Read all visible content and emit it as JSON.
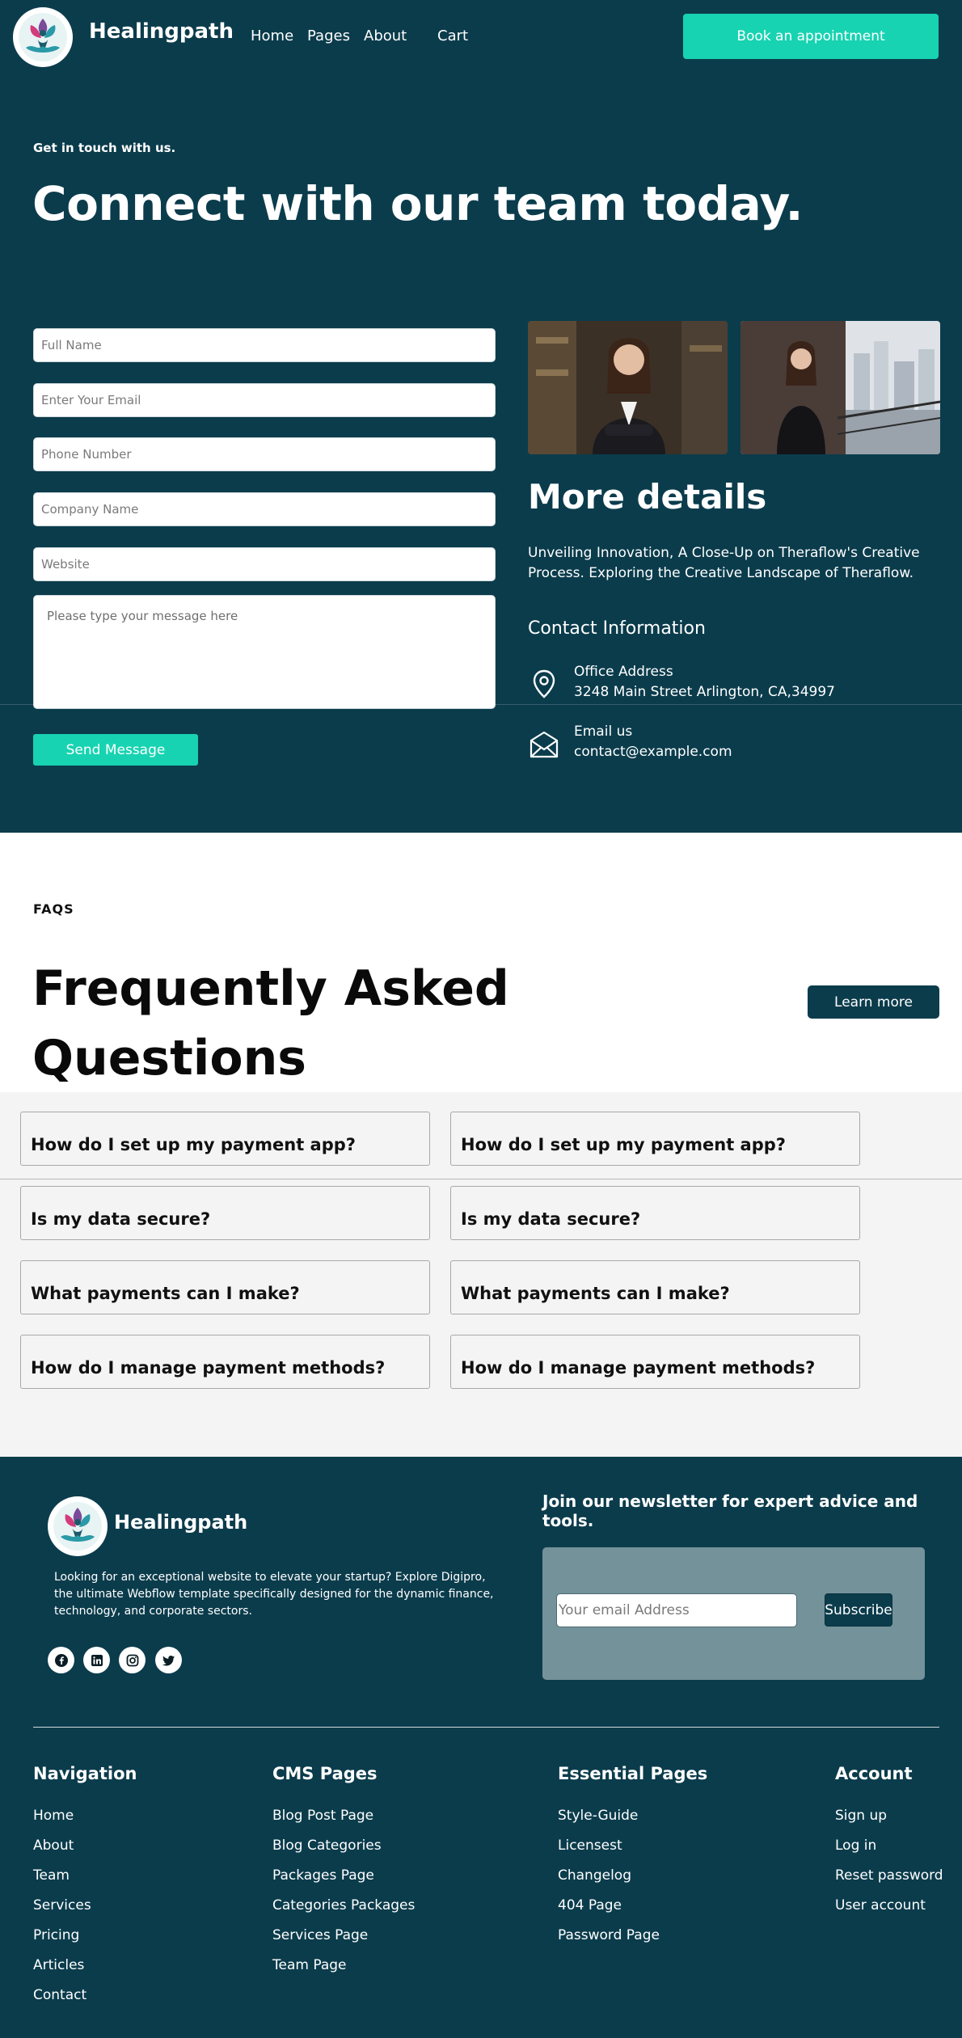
{
  "header": {
    "brand": "Healingpath",
    "nav": [
      "Home",
      "Pages",
      "About",
      "Cart"
    ],
    "cta": "Book an appointment"
  },
  "hero": {
    "eyebrow": "Get in touch with us.",
    "title": "Connect with our team today."
  },
  "form": {
    "full_name_placeholder": "Full Name",
    "email_placeholder": "Enter Your Email",
    "phone_placeholder": "Phone Number",
    "company_placeholder": "Company Name",
    "website_placeholder": "Website",
    "message_placeholder": "Please type your message here",
    "submit_label": "Send Message"
  },
  "details": {
    "title": "More details",
    "description": "Unveiling Innovation, A Close-Up on Theraflow's Creative Process. Exploring the Creative Landscape of Theraflow.",
    "contact_heading": "Contact Information",
    "office_label": "Office Address",
    "office_value": "3248 Main Street Arlington, CA,34997",
    "email_label": "Email us",
    "email_value": "contact@example.com"
  },
  "faq": {
    "eyebrow": "FAQS",
    "title": "Frequently Asked Questions",
    "learn_more": "Learn more",
    "questions_left": [
      "How do I set up my payment app?",
      "Is my data secure?",
      "What payments can I make?",
      "How do I manage payment methods?"
    ],
    "questions_right": [
      "How do I set up my payment app?",
      "Is my data secure?",
      "What payments can I make?",
      "How do I manage payment methods?"
    ]
  },
  "footer": {
    "brand": "Healingpath",
    "description": "Looking for an exceptional website to elevate your startup? Explore Digipro, the ultimate Webflow template specifically designed for the dynamic finance, technology, and corporate sectors.",
    "social_icons": [
      "facebook-icon",
      "linkedin-icon",
      "instagram-icon",
      "twitter-icon"
    ],
    "newsletter_title": "Join our newsletter for expert advice and tools.",
    "newsletter_placeholder": "Your email Address",
    "subscribe_label": "Subscribe",
    "columns": [
      {
        "title": "Navigation",
        "links": [
          "Home",
          "About",
          "Team",
          "Services",
          "Pricing",
          "Articles",
          "Contact"
        ]
      },
      {
        "title": "CMS Pages",
        "links": [
          "Blog Post Page",
          "Blog Categories",
          "Packages Page",
          "Categories Packages",
          "Services Page",
          "Team Page"
        ]
      },
      {
        "title": "Essential Pages",
        "links": [
          "Style-Guide",
          "Licensest",
          "Changelog",
          "404 Page",
          "Password Page"
        ]
      },
      {
        "title": "Account",
        "links": [
          "Sign up",
          "Log in",
          "Reset password",
          "User account"
        ]
      }
    ]
  },
  "colors": {
    "primary_dark": "#0b3c4c",
    "accent": "#17d3b1",
    "faq_band": "#f4f4f4",
    "newsletter_box": "#74929a"
  }
}
